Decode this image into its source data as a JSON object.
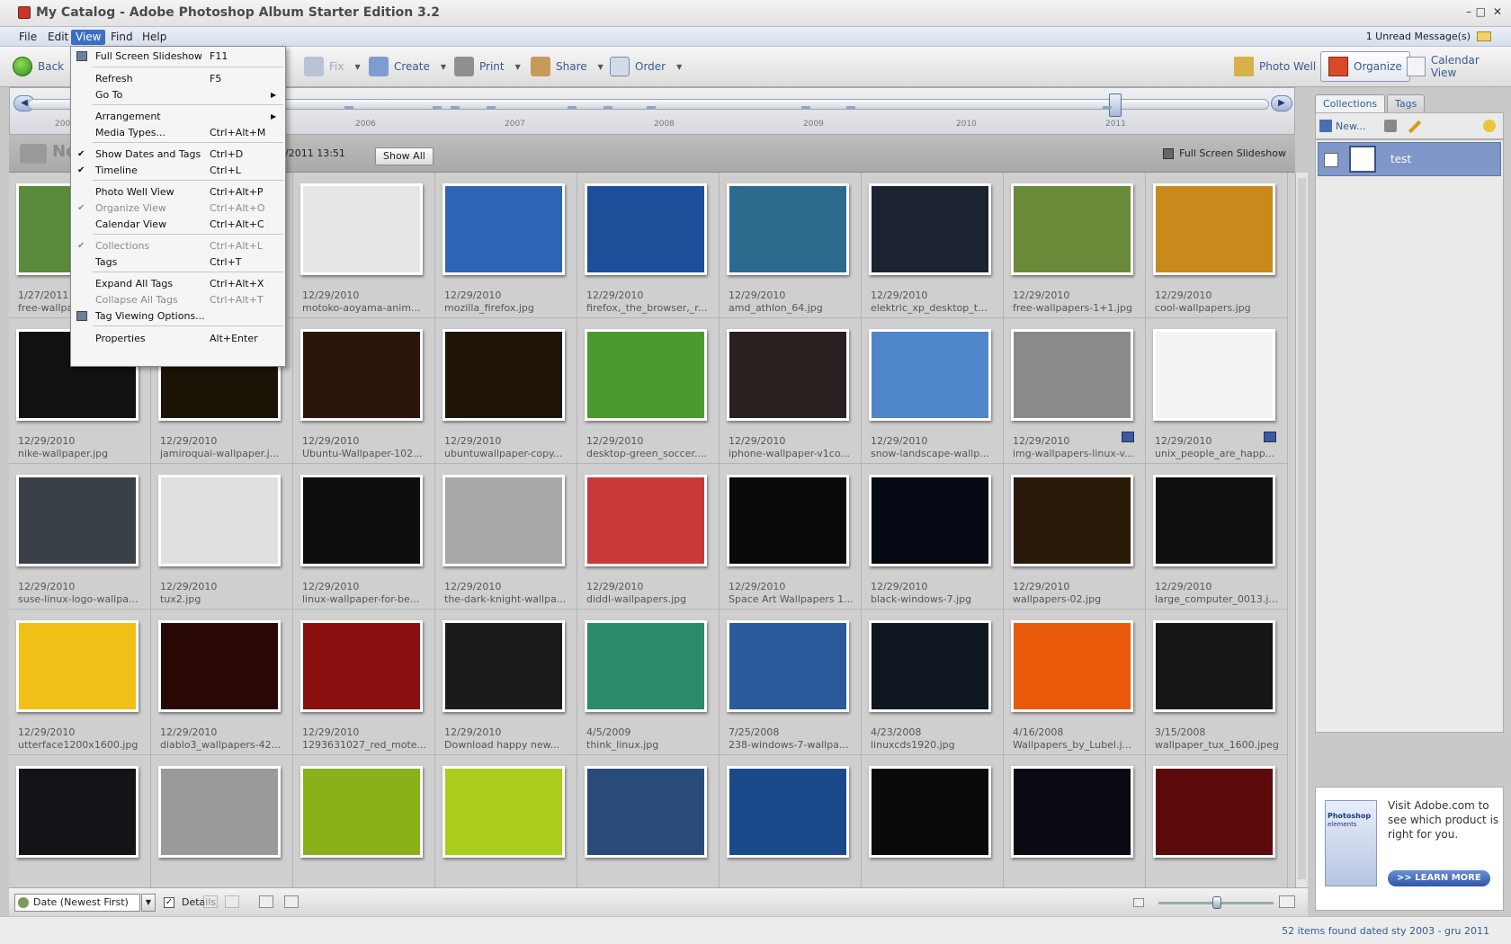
{
  "window": {
    "title": "My Catalog - Adobe Photoshop Album Starter Edition 3.2"
  },
  "menubar": {
    "items": [
      "File",
      "Edit",
      "View",
      "Find",
      "Help"
    ],
    "unread": "1 Unread Message(s)"
  },
  "toolbar": {
    "back": "Back",
    "fix": "Fix",
    "create": "Create",
    "print": "Print",
    "share": "Share",
    "order": "Order",
    "photo_well": "Photo Well",
    "organize": "Organize",
    "calendar_view": "Calendar View"
  },
  "timeline": {
    "years": [
      "200",
      "2006",
      "2007",
      "2008",
      "2009",
      "2010",
      "2011"
    ]
  },
  "filterbar": {
    "title_partial": "Ne",
    "date_partial": "6/2011 13:51",
    "show_all": "Show All",
    "fullscreen": "Full Screen Slideshow"
  },
  "view_menu": {
    "items": [
      {
        "label": "Full Screen Slideshow",
        "shortcut": "F11",
        "icon": "slideshow-icon"
      },
      {
        "label": "Refresh",
        "shortcut": "F5"
      },
      {
        "label": "Go To",
        "shortcut": "",
        "submenu": true
      },
      {
        "label": "Arrangement",
        "shortcut": "",
        "submenu": true
      },
      {
        "label": "Media Types...",
        "shortcut": "Ctrl+Alt+M"
      },
      {
        "label": "Show Dates and Tags",
        "shortcut": "Ctrl+D",
        "checked": true
      },
      {
        "label": "Timeline",
        "shortcut": "Ctrl+L",
        "checked": true
      },
      {
        "label": "Photo Well View",
        "shortcut": "Ctrl+Alt+P"
      },
      {
        "label": "Organize View",
        "shortcut": "Ctrl+Alt+O",
        "checked": true,
        "disabled": true
      },
      {
        "label": "Calendar View",
        "shortcut": "Ctrl+Alt+C"
      },
      {
        "label": "Collections",
        "shortcut": "Ctrl+Alt+L",
        "checked": true,
        "disabled": true
      },
      {
        "label": "Tags",
        "shortcut": "Ctrl+T"
      },
      {
        "label": "Expand All Tags",
        "shortcut": "Ctrl+Alt+X"
      },
      {
        "label": "Collapse All Tags",
        "shortcut": "Ctrl+Alt+T",
        "disabled": true
      },
      {
        "label": "Tag Viewing Options...",
        "shortcut": "",
        "icon": "tag-options-icon"
      },
      {
        "label": "Properties",
        "shortcut": "Alt+Enter"
      }
    ]
  },
  "photos": [
    {
      "date": "1/27/2011",
      "name": "free-wallpa",
      "color": "#5a8a3a"
    },
    {
      "date": "",
      "name": "",
      "color": "#cccccc"
    },
    {
      "date": "12/29/2010",
      "name": "motoko-aoyama-anim...",
      "color": "#e6e6e6"
    },
    {
      "date": "12/29/2010",
      "name": "mozilla_firefox.jpg",
      "color": "#2f63b4"
    },
    {
      "date": "12/29/2010",
      "name": "firefox,_the_browser,_r...",
      "color": "#1c4e9a"
    },
    {
      "date": "12/29/2010",
      "name": "amd_athlon_64.jpg",
      "color": "#2c6b8e"
    },
    {
      "date": "12/29/2010",
      "name": "elektric_xp_desktop_t...",
      "color": "#1b2230"
    },
    {
      "date": "12/29/2010",
      "name": "free-wallpapers-1+1.jpg",
      "color": "#6a8a3a"
    },
    {
      "date": "12/29/2010",
      "name": "cool-wallpapers.jpg",
      "color": "#c88a1a"
    },
    {
      "date": "12/29/2010",
      "name": "nike-wallpaper.jpg",
      "color": "#111111"
    },
    {
      "date": "12/29/2010",
      "name": "jamiroquai-wallpaper.j...",
      "color": "#1a1406"
    },
    {
      "date": "12/29/2010",
      "name": "Ubuntu-Wallpaper-102...",
      "color": "#2a160a"
    },
    {
      "date": "12/29/2010",
      "name": "ubuntuwallpaper-copy...",
      "color": "#1e1408"
    },
    {
      "date": "12/29/2010",
      "name": "desktop-green_soccer....",
      "color": "#4a9a2e"
    },
    {
      "date": "12/29/2010",
      "name": "iphone-wallpaper-v1co...",
      "color": "#2a2020"
    },
    {
      "date": "12/29/2010",
      "name": "snow-landscape-wallp...",
      "color": "#4f86c8"
    },
    {
      "date": "12/29/2010",
      "name": "img-wallpapers-linux-v...",
      "color": "#8a8a8a",
      "tag": true
    },
    {
      "date": "12/29/2010",
      "name": "unix_people_are_happ...",
      "color": "#f3f3f3",
      "tag": true
    },
    {
      "date": "12/29/2010",
      "name": "suse-linux-logo-wallpa...",
      "color": "#3a4048"
    },
    {
      "date": "12/29/2010",
      "name": "tux2.jpg",
      "color": "#e0e0e0"
    },
    {
      "date": "12/29/2010",
      "name": "linux-wallpaper-for-be...",
      "color": "#0e0e0e"
    },
    {
      "date": "12/29/2010",
      "name": "the-dark-knight-wallpa...",
      "color": "#a8a8a8"
    },
    {
      "date": "12/29/2010",
      "name": "diddl-wallpapers.jpg",
      "color": "#c83a3a"
    },
    {
      "date": "12/29/2010",
      "name": "Space Art Wallpapers 1...",
      "color": "#0a0a0a"
    },
    {
      "date": "12/29/2010",
      "name": "black-windows-7.jpg",
      "color": "#050a14"
    },
    {
      "date": "12/29/2010",
      "name": "wallpapers-02.jpg",
      "color": "#2a1a0a"
    },
    {
      "date": "12/29/2010",
      "name": "large_computer_0013.j...",
      "color": "#101010"
    },
    {
      "date": "12/29/2010",
      "name": "utterface1200x1600.jpg",
      "color": "#f0c018"
    },
    {
      "date": "12/29/2010",
      "name": "diablo3_wallpapers-42...",
      "color": "#2a0808"
    },
    {
      "date": "12/29/2010",
      "name": "1293631027_red_mote...",
      "color": "#8a1010"
    },
    {
      "date": "12/29/2010",
      "name": "Download happy new...",
      "color": "#1a1a1a"
    },
    {
      "date": "4/5/2009",
      "name": "think_linux.jpg",
      "color": "#2a8a6a"
    },
    {
      "date": "7/25/2008",
      "name": "238-windows-7-wallpa...",
      "color": "#2a5a9a"
    },
    {
      "date": "4/23/2008",
      "name": "linuxcds1920.jpg",
      "color": "#0e1620"
    },
    {
      "date": "4/16/2008",
      "name": "Wallpapers_by_Lubel.j...",
      "color": "#e85a0a"
    },
    {
      "date": "3/15/2008",
      "name": "wallpaper_tux_1600.jpeg",
      "color": "#151515"
    },
    {
      "date": "",
      "name": "",
      "color": "#121418"
    },
    {
      "date": "",
      "name": "",
      "color": "#9a9a9a"
    },
    {
      "date": "",
      "name": "",
      "color": "#8ab01a"
    },
    {
      "date": "",
      "name": "",
      "color": "#aacc1a"
    },
    {
      "date": "",
      "name": "",
      "color": "#2a4a7a"
    },
    {
      "date": "",
      "name": "",
      "color": "#1a4a8a"
    },
    {
      "date": "",
      "name": "",
      "color": "#0a0a0a"
    },
    {
      "date": "",
      "name": "",
      "color": "#0a0a12"
    },
    {
      "date": "",
      "name": "",
      "color": "#5a0a0a"
    }
  ],
  "bottombar": {
    "sort": "Date (Newest First)",
    "details": "Details"
  },
  "status": "52 items found dated sty 2003 - gru 2011",
  "rightpanel": {
    "tabs": [
      "Collections",
      "Tags"
    ],
    "new": "New...",
    "collection": "test",
    "ad_text": "Visit Adobe.com to see which product is right for you.",
    "ad_brand": "Photoshop",
    "ad_brand_sub": "elements",
    "learn_more": ">> LEARN MORE"
  }
}
